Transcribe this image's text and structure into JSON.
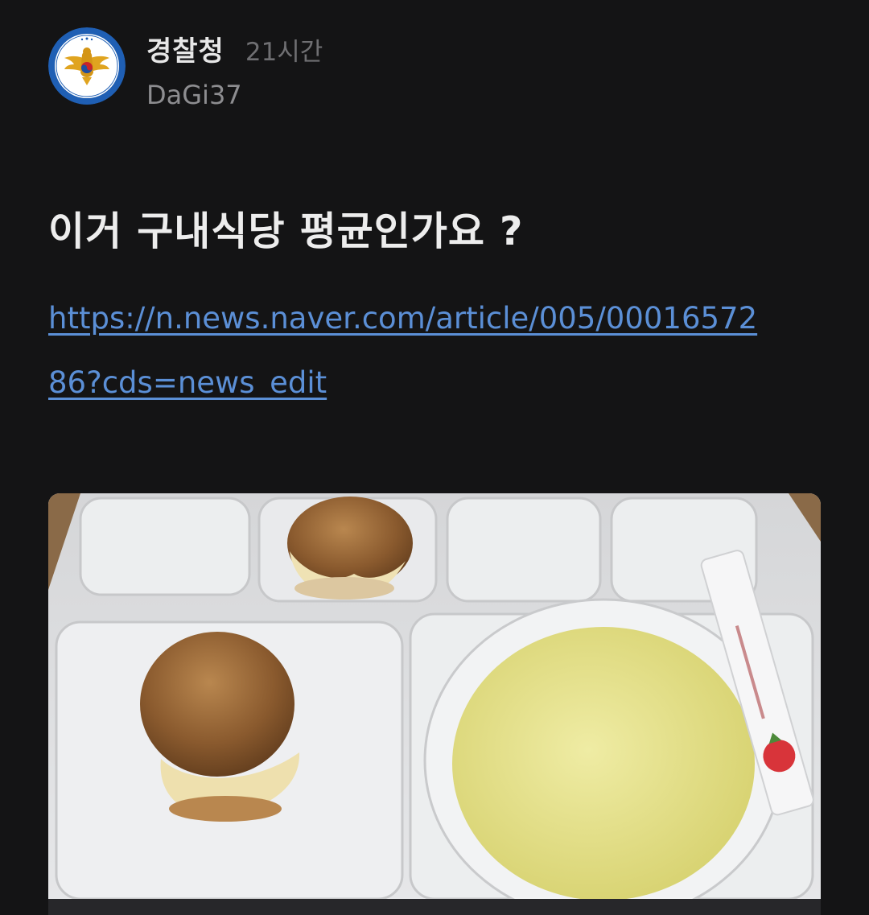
{
  "post": {
    "author": "경찰청",
    "time": "21시간",
    "username": "DaGi37",
    "title": "이거 구내식당 평균인가요 ?",
    "link": "https://n.news.naver.com/article/005/0001657286?cds=news_edit"
  },
  "icons": {
    "avatar": "korean-national-police-emblem",
    "photo": "cafeteria-meal-tray-photo"
  },
  "colors": {
    "background": "#141415",
    "link": "#5b8fd6",
    "avatar_ring": "#1f5fb4"
  }
}
